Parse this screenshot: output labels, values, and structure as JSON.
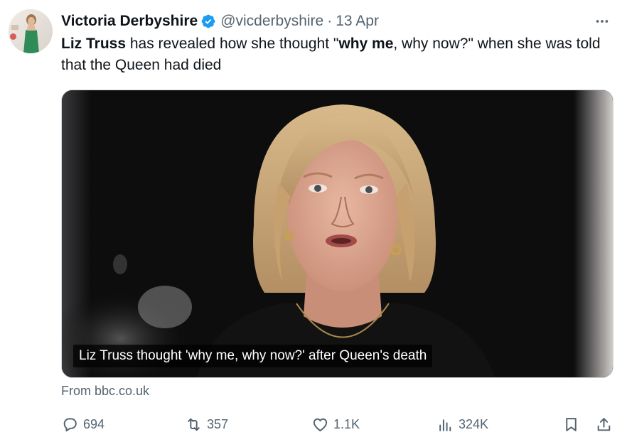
{
  "tweet": {
    "author": {
      "display_name": "Victoria Derbyshire",
      "handle": "@vicderbyshire",
      "verified": true
    },
    "separator": "·",
    "date": "13 Apr",
    "text": {
      "part1_bold": "Liz Truss",
      "part2": " has revealed how she thought \"",
      "part3_bold": "why me",
      "part4": ", why now?\" when she was told that the Queen had died"
    },
    "media": {
      "caption": "Liz Truss thought 'why me, why now?' after Queen's death"
    },
    "source": "From bbc.co.uk"
  },
  "actions": {
    "replies": "694",
    "reposts": "357",
    "likes": "1.1K",
    "views": "324K"
  },
  "colors": {
    "text": "#0f1419",
    "secondary": "#536471",
    "verified_blue": "#1d9bf0"
  },
  "icons": [
    "more-icon",
    "verified-badge-icon",
    "reply-icon",
    "repost-icon",
    "like-icon",
    "views-icon",
    "bookmark-icon",
    "share-icon"
  ]
}
